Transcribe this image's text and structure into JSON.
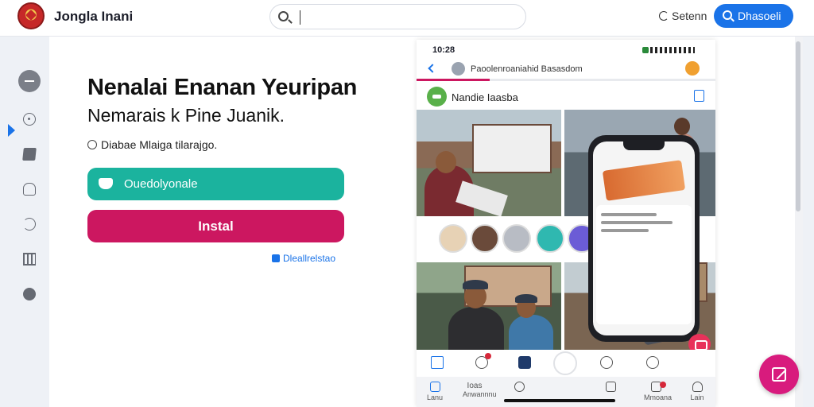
{
  "app": {
    "title": "Jongla Inani"
  },
  "search": {
    "placeholder": "",
    "value": ""
  },
  "header": {
    "search_link": "Setenn",
    "primary_button": "Dhasoeli"
  },
  "sidebar": {
    "items": [
      {
        "name": "minus-icon",
        "active": true
      },
      {
        "name": "circle-icon"
      },
      {
        "name": "note-icon"
      },
      {
        "name": "lock-icon"
      },
      {
        "name": "sync-icon"
      },
      {
        "name": "bars-icon"
      },
      {
        "name": "heart-icon"
      }
    ]
  },
  "main": {
    "headline": "Nenalai Enanan Yeuripan",
    "subhead": "Nemarais k Pine Juanik.",
    "option_label": "Diabae Mlaiga tilarajgo.",
    "teal_button": "Ouedolyonale",
    "pink_button": "Instal",
    "small_link": "Dleallrelstao"
  },
  "phone": {
    "time": "10:28",
    "nav_title": "Paoolenroaniahid Basasdom",
    "account_name": "Nandie Iaasba",
    "tabs_bottom": [
      {
        "label": "Lanu"
      },
      {
        "label": "Ioas",
        "sublabel": "Anwannnu"
      },
      {
        "label": ""
      },
      {
        "label": ""
      },
      {
        "label": "Mmoana"
      },
      {
        "label": "Lain"
      }
    ]
  },
  "colors": {
    "accent": "#1a73e8",
    "teal": "#1bb39e",
    "pink": "#cc1760",
    "fab": "#d81b7d"
  }
}
